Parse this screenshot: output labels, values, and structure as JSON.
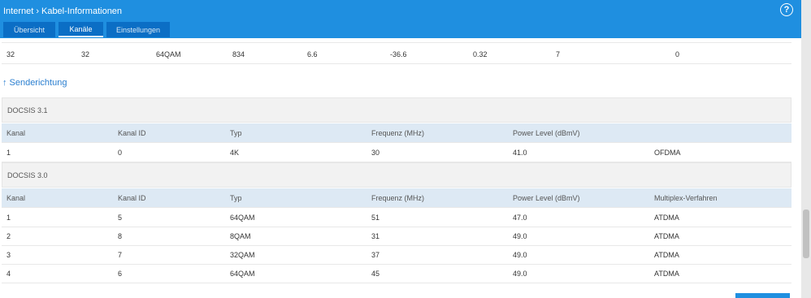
{
  "header": {
    "breadcrumb_root": "Internet",
    "breadcrumb_sep": "›",
    "breadcrumb_current": "Kabel-Informationen",
    "help_label": "?"
  },
  "tabs": [
    {
      "label": "Übersicht"
    },
    {
      "label": "Kanäle"
    },
    {
      "label": "Einstellungen"
    }
  ],
  "downstream_last": {
    "cols": [
      "32",
      "32",
      "64QAM",
      "834",
      "6.6",
      "-36.6",
      "0.32",
      "7",
      "0"
    ]
  },
  "upstream": {
    "title": "Senderichtung",
    "arrow": "↑",
    "docsis31": {
      "label": "DOCSIS 3.1",
      "headers": [
        "Kanal",
        "Kanal ID",
        "Typ",
        "Frequenz (MHz)",
        "Power Level (dBmV)",
        ""
      ],
      "rows": [
        [
          "1",
          "0",
          "4K",
          "30",
          "41.0",
          "OFDMA"
        ]
      ]
    },
    "docsis30": {
      "label": "DOCSIS 3.0",
      "headers": [
        "Kanal",
        "Kanal ID",
        "Typ",
        "Frequenz (MHz)",
        "Power Level (dBmV)",
        "Multiplex-Verfahren"
      ],
      "rows": [
        [
          "1",
          "5",
          "64QAM",
          "51",
          "47.0",
          "ATDMA"
        ],
        [
          "2",
          "8",
          "8QAM",
          "31",
          "49.0",
          "ATDMA"
        ],
        [
          "3",
          "7",
          "32QAM",
          "37",
          "49.0",
          "ATDMA"
        ],
        [
          "4",
          "6",
          "64QAM",
          "45",
          "49.0",
          "ATDMA"
        ]
      ]
    }
  },
  "colors": {
    "header": "#1f8fe0",
    "tab": "#0b6ec5",
    "table_header": "#dde9f4",
    "section_title": "#2b7fd0"
  }
}
